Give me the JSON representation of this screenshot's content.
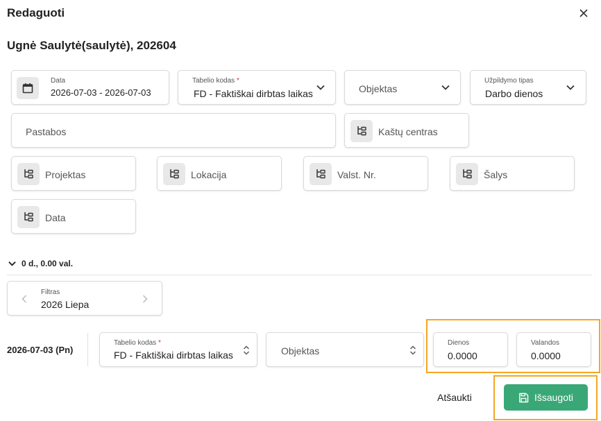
{
  "dialog": {
    "title": "Redaguoti",
    "subtitle": "Ugnė Saulytė(saulytė), 202604"
  },
  "form": {
    "date": {
      "label": "Data",
      "value": "2026-07-03 - 2026-07-03"
    },
    "tabelio_kodas": {
      "label": "Tabelio kodas",
      "required_mark": "*",
      "value": "FD - Faktiškai dirbtas laikas"
    },
    "objektas": {
      "placeholder": "Objektas"
    },
    "uzpildymo_tipas": {
      "label": "Užpildymo tipas",
      "value": "Darbo dienos"
    },
    "pastabos": {
      "placeholder": "Pastabos"
    },
    "kastu_centras": {
      "label": "Kaštų centras"
    },
    "projektas": {
      "label": "Projektas"
    },
    "lokacija": {
      "label": "Lokacija"
    },
    "valst_nr": {
      "label": "Valst. Nr."
    },
    "salys": {
      "label": "Šalys"
    },
    "data2": {
      "label": "Data"
    }
  },
  "summary": {
    "text": "0 d., 0.00 val."
  },
  "filter": {
    "label": "Filtras",
    "value": "2026 Liepa"
  },
  "row": {
    "date": "2026-07-03 (Pn)",
    "tabelio_kodas": {
      "label": "Tabelio kodas",
      "required_mark": "*",
      "value": "FD - Faktiškai dirbtas laikas"
    },
    "objektas": {
      "placeholder": "Objektas"
    },
    "dienos": {
      "label": "Dienos",
      "value": "0.0000"
    },
    "valandos": {
      "label": "Valandos",
      "value": "0.0000"
    }
  },
  "actions": {
    "cancel_label": "Atšaukti",
    "save_label": "Išsaugoti"
  },
  "colors": {
    "accent": "#3aa876",
    "highlight": "#f5a623",
    "required": "#d32f2f"
  }
}
